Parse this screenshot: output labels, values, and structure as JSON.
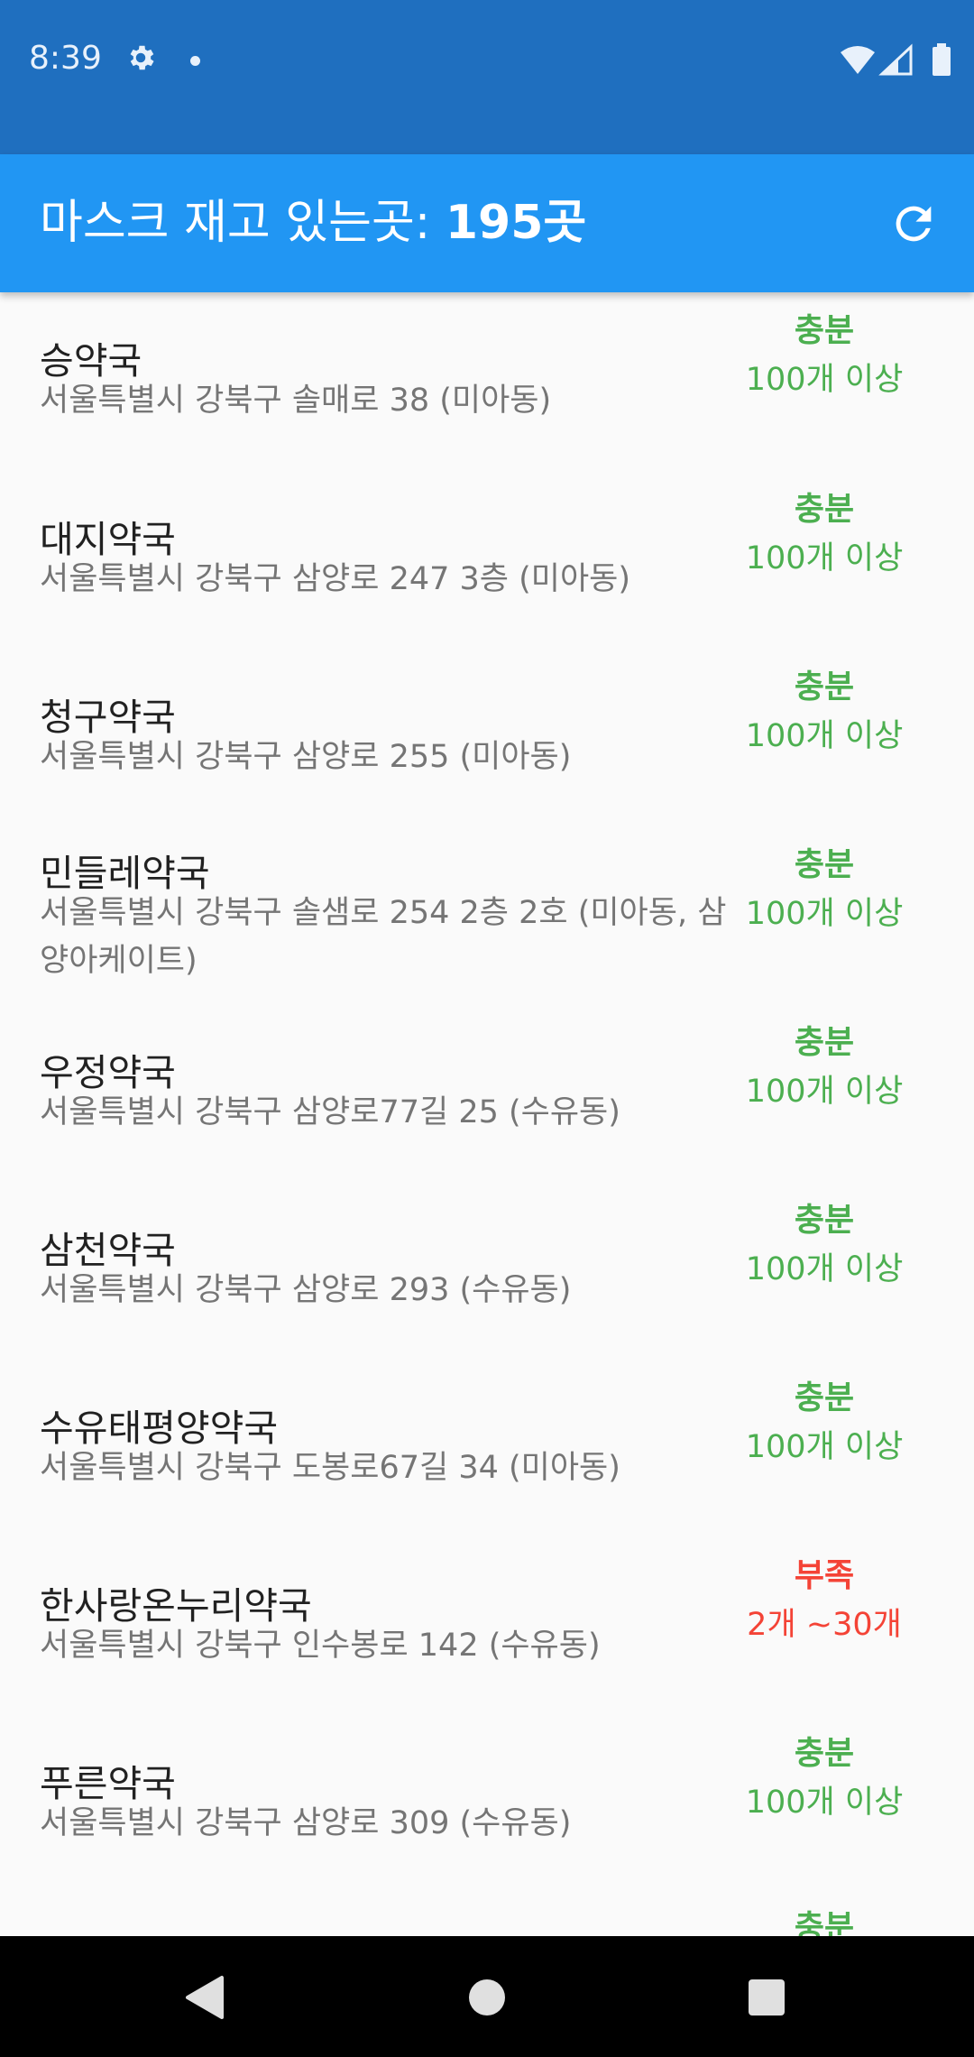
{
  "status_bar": {
    "time": "8:39",
    "icons": [
      "gear-icon",
      "dot-icon",
      "wifi-icon",
      "signal-icon",
      "battery-icon"
    ]
  },
  "app_bar": {
    "title_prefix": "마스크 재고 있는곳: ",
    "title_count": "195곳",
    "refresh_icon": "refresh-icon"
  },
  "colors": {
    "status_bar": "#1f6fbf",
    "app_bar": "#2196f3",
    "sufficient": "#4caf50",
    "insufficient": "#f44336"
  },
  "stores": [
    {
      "name": "승약국",
      "address": "서울특별시 강북구 솔매로 38 (미아동)",
      "stock_level": "충분",
      "stock_qty": "100개 이상",
      "status": "green"
    },
    {
      "name": "대지약국",
      "address": "서울특별시 강북구 삼양로 247 3층 (미아동)",
      "stock_level": "충분",
      "stock_qty": "100개 이상",
      "status": "green"
    },
    {
      "name": "청구약국",
      "address": "서울특별시 강북구 삼양로 255 (미아동)",
      "stock_level": "충분",
      "stock_qty": "100개 이상",
      "status": "green"
    },
    {
      "name": "민들레약국",
      "address": "서울특별시 강북구 솔샘로 254 2층 2호 (미아동, 삼양아케이트)",
      "stock_level": "충분",
      "stock_qty": "100개 이상",
      "status": "green"
    },
    {
      "name": "우정약국",
      "address": "서울특별시 강북구 삼양로77길 25 (수유동)",
      "stock_level": "충분",
      "stock_qty": "100개 이상",
      "status": "green"
    },
    {
      "name": "삼천약국",
      "address": "서울특별시 강북구 삼양로 293 (수유동)",
      "stock_level": "충분",
      "stock_qty": "100개 이상",
      "status": "green"
    },
    {
      "name": "수유태평양약국",
      "address": "서울특별시 강북구 도봉로67길 34 (미아동)",
      "stock_level": "충분",
      "stock_qty": "100개 이상",
      "status": "green"
    },
    {
      "name": "한사랑온누리약국",
      "address": "서울특별시 강북구 인수봉로 142 (수유동)",
      "stock_level": "부족",
      "stock_qty": "2개 ~30개",
      "status": "red"
    },
    {
      "name": "푸른약국",
      "address": "서울특별시 강북구 삼양로 309 (수유동)",
      "stock_level": "충분",
      "stock_qty": "100개 이상",
      "status": "green"
    },
    {
      "name": "",
      "address": "",
      "stock_level": "충분",
      "stock_qty": "",
      "status": "green"
    }
  ],
  "nav_bar": {
    "icons": [
      "back-icon",
      "home-icon",
      "recents-icon"
    ]
  }
}
